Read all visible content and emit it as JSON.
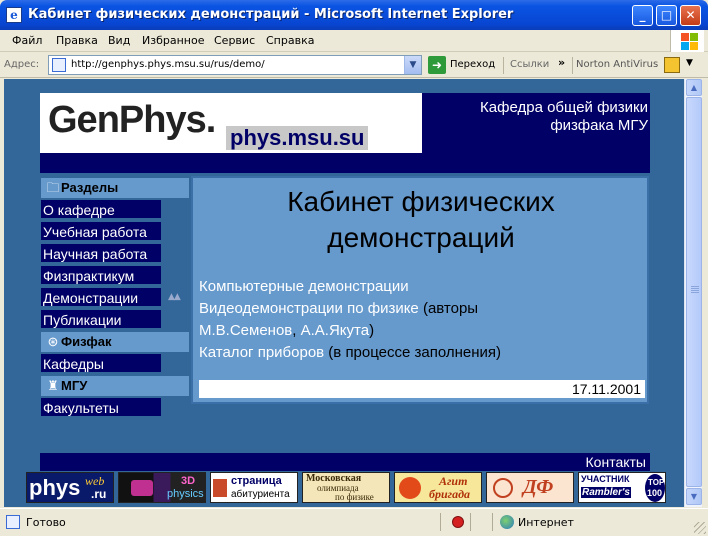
{
  "window": {
    "title": "Кабинет физических демонстраций - Microsoft Internet Explorer",
    "buttons": {
      "minimize": "_",
      "maximize": "□",
      "close": "✕"
    }
  },
  "menu": [
    "Файл",
    "Правка",
    "Вид",
    "Избранное",
    "Сервис",
    "Справка"
  ],
  "address_bar": {
    "label": "Адрес:",
    "url": "http://genphys.phys.msu.su/rus/demo/",
    "go_label": "Переход",
    "links_label": "Ссылки",
    "toolbar_extension": "Norton AntiVirus"
  },
  "page": {
    "logo": {
      "main": "GenPhys.",
      "sub": "phys.msu.su"
    },
    "tagline": [
      "Кафедра общей физики",
      "физфака МГУ"
    ],
    "nav": {
      "sections": [
        {
          "label": "Разделы",
          "icon": "folder-icon",
          "glyph": "🗀"
        },
        {
          "label": "Физфак",
          "icon": "atom-icon",
          "glyph": "⊛"
        },
        {
          "label": "МГУ",
          "icon": "building-icon",
          "glyph": "♜"
        }
      ],
      "items": [
        "О кафедре",
        "Учебная работа",
        "Научная работа",
        "Физпрактикум",
        "Демонстрации",
        "Публикации",
        "Кафедры",
        "Факультеты"
      ],
      "arrows": "▲▲"
    },
    "content": {
      "title_line1": "Кабинет физических",
      "title_line2": "демонстраций",
      "links": {
        "computer_demos": "Компьютерные демонстрации",
        "video_demos": "Видеодемонстрации по физике",
        "authors_open": " (авторы",
        "author1": "М.В.Семенов",
        "comma": ", ",
        "author2": "А.А.Якута",
        "authors_close": ")",
        "catalog": "Каталог приборов",
        "catalog_note": " (в процессе заполнения)"
      },
      "date": "17.11.2001"
    },
    "footer": {
      "contacts": "Контакты"
    },
    "banners": {
      "physweb": {
        "a": "phys",
        "b": "web",
        "c": ".ru"
      },
      "physics3d": {
        "a": "3D",
        "b": "physics"
      },
      "abiturient": {
        "a": "страница",
        "b": "абитуриента"
      },
      "olympiad": {
        "a": "Московская",
        "b": "олимпиада",
        "c": "по физике"
      },
      "agitbrigada": {
        "a": "Агит",
        "b": "бригада"
      },
      "df": {
        "a": "ДФ"
      },
      "rambler": {
        "a": "УЧАСТНИК",
        "b": "Rambler's",
        "c": "TOP",
        "d": "100"
      }
    }
  },
  "status_bar": {
    "text": "Готово",
    "zone": "Интернет"
  }
}
